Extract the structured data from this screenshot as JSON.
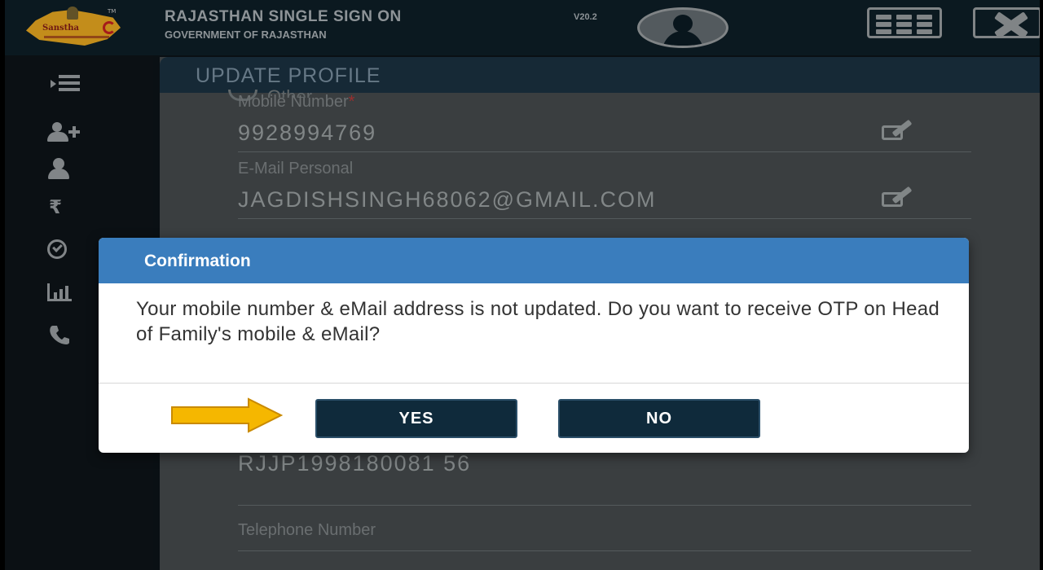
{
  "header": {
    "title": "RAJASTHAN SINGLE SIGN ON",
    "version": "V20.2",
    "subtitle": "GOVERNMENT OF RAJASTHAN",
    "logo_text": "Sanstha",
    "logo_tm": "TM",
    "icons": [
      "apps-grid-icon",
      "close-icon",
      "user-avatar-icon"
    ]
  },
  "sidebar": {
    "items": [
      {
        "icon": "menu-icon"
      },
      {
        "icon": "add-user-icon"
      },
      {
        "icon": "user-icon"
      },
      {
        "icon": "rupee-icon",
        "glyph": "₹"
      },
      {
        "icon": "check-circle-icon"
      },
      {
        "icon": "bar-chart-icon"
      },
      {
        "icon": "phone-icon",
        "glyph": "📞"
      }
    ]
  },
  "main": {
    "title": "UPDATE PROFILE",
    "ghost_option": "Other",
    "fields": {
      "mobile_label": "Mobile Number",
      "mobile_required": "*",
      "mobile_value": "9928994769",
      "email_label": "E-Mail Personal",
      "email_value": "JAGDISHSINGH68062@GMAIL.COM",
      "jan_aadhaar_value": "RJJP1998180081 56",
      "telephone_label": "Telephone Number"
    }
  },
  "dialog": {
    "title": "Confirmation",
    "message": "Your mobile number & eMail address is not updated. Do you want to receive OTP on Head of Family's mobile & eMail?",
    "yes_label": "YES",
    "no_label": "NO"
  },
  "colors": {
    "header_bg": "#0d1c23",
    "dialog_header": "#3a7dbd",
    "button_bg": "#0f2a3b",
    "arrow": "#f5b700"
  }
}
